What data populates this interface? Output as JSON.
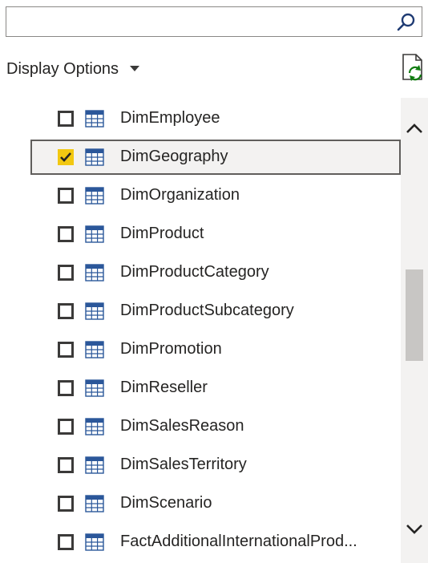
{
  "search": {
    "value": "",
    "placeholder": ""
  },
  "toolbar": {
    "display_options_label": "Display Options"
  },
  "tables": [
    {
      "name": "DimEmployee",
      "checked": false,
      "selected": false
    },
    {
      "name": "DimGeography",
      "checked": true,
      "selected": true
    },
    {
      "name": "DimOrganization",
      "checked": false,
      "selected": false
    },
    {
      "name": "DimProduct",
      "checked": false,
      "selected": false
    },
    {
      "name": "DimProductCategory",
      "checked": false,
      "selected": false
    },
    {
      "name": "DimProductSubcategory",
      "checked": false,
      "selected": false
    },
    {
      "name": "DimPromotion",
      "checked": false,
      "selected": false
    },
    {
      "name": "DimReseller",
      "checked": false,
      "selected": false
    },
    {
      "name": "DimSalesReason",
      "checked": false,
      "selected": false
    },
    {
      "name": "DimSalesTerritory",
      "checked": false,
      "selected": false
    },
    {
      "name": "DimScenario",
      "checked": false,
      "selected": false
    },
    {
      "name": "FactAdditionalInternationalProd...",
      "checked": false,
      "selected": false
    }
  ],
  "icons": {
    "search": "search-icon",
    "display_options_caret": "caret-down-icon",
    "refresh": "refresh-icon",
    "table": "table-icon",
    "scroll_up": "chevron-up-icon",
    "scroll_down": "chevron-down-icon"
  },
  "colors": {
    "accent_checkbox": "#f2c811",
    "table_icon_blue": "#2b579a",
    "refresh_green": "#107c10"
  }
}
